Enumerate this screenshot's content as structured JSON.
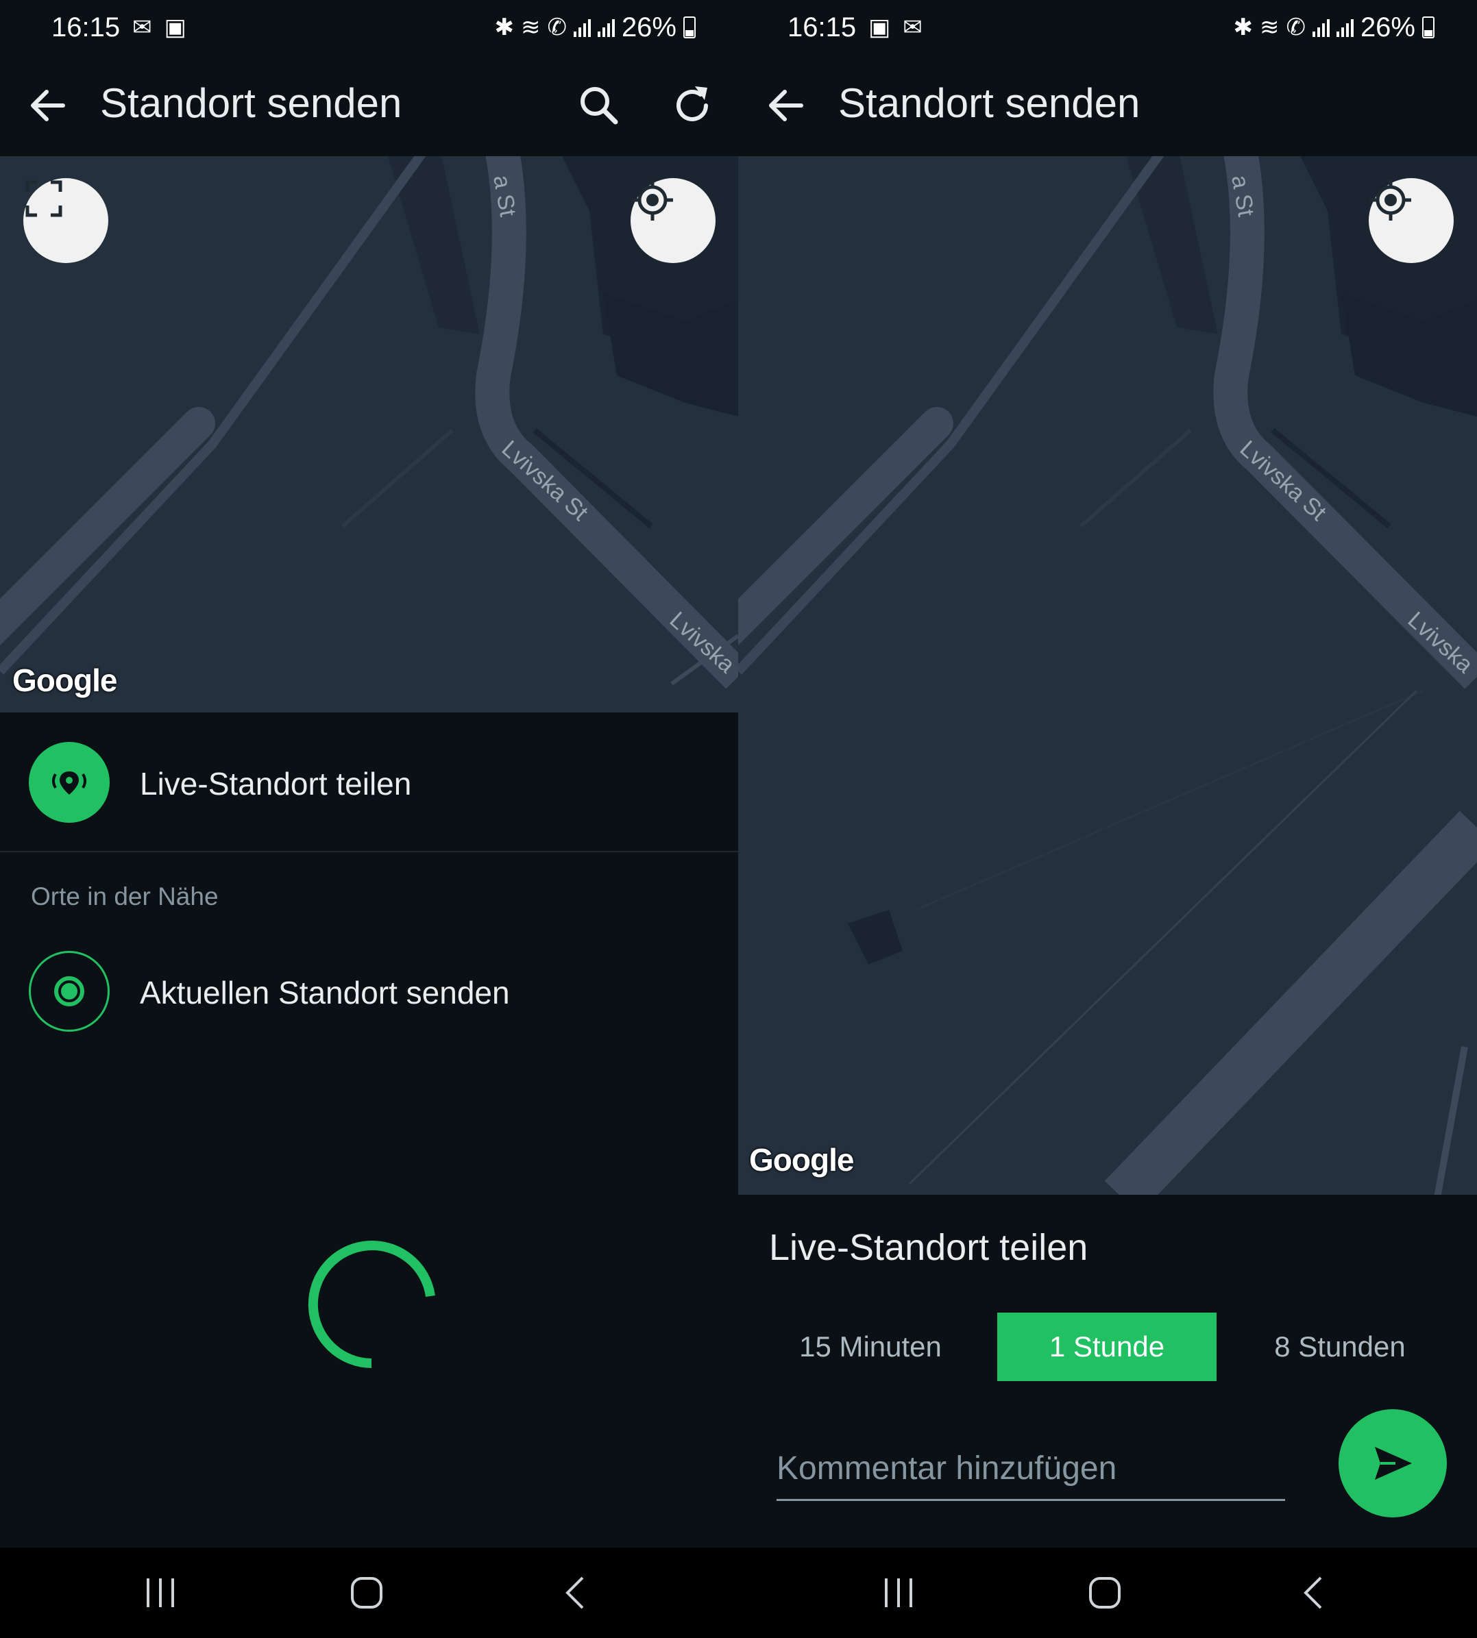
{
  "left": {
    "status": {
      "time": "16:15",
      "battery": "26%"
    },
    "appbar": {
      "title": "Standort senden"
    },
    "map": {
      "google_label": "Google",
      "street_1": "a St",
      "street_2": "Lvivska St",
      "street_3": "Lvivska"
    },
    "live_share_label": "Live-Standort teilen",
    "nearby_header": "Orte in der Nähe",
    "current_location_label": "Aktuellen Standort senden",
    "loading": true
  },
  "right": {
    "status": {
      "time": "16:15",
      "battery": "26%"
    },
    "appbar": {
      "title": "Standort senden"
    },
    "map": {
      "google_label": "Google",
      "street_1": "a St",
      "street_2": "Lvivska St",
      "street_3": "Lvivska"
    },
    "sheet_title": "Live-Standort teilen",
    "durations": [
      {
        "label": "15 Minuten",
        "selected": false
      },
      {
        "label": "1 Stunde",
        "selected": true
      },
      {
        "label": "8 Stunden",
        "selected": false
      }
    ],
    "comment_placeholder": "Kommentar hinzufügen"
  },
  "icons": {
    "back": "arrow-left-icon",
    "search": "search-icon",
    "refresh": "refresh-icon",
    "fullscreen": "fullscreen-icon",
    "my_location": "my-location-icon",
    "live_location": "live-location-icon",
    "send": "send-icon"
  },
  "colors": {
    "accent": "#21c063",
    "background": "#0b1014",
    "map": "#24303e"
  }
}
